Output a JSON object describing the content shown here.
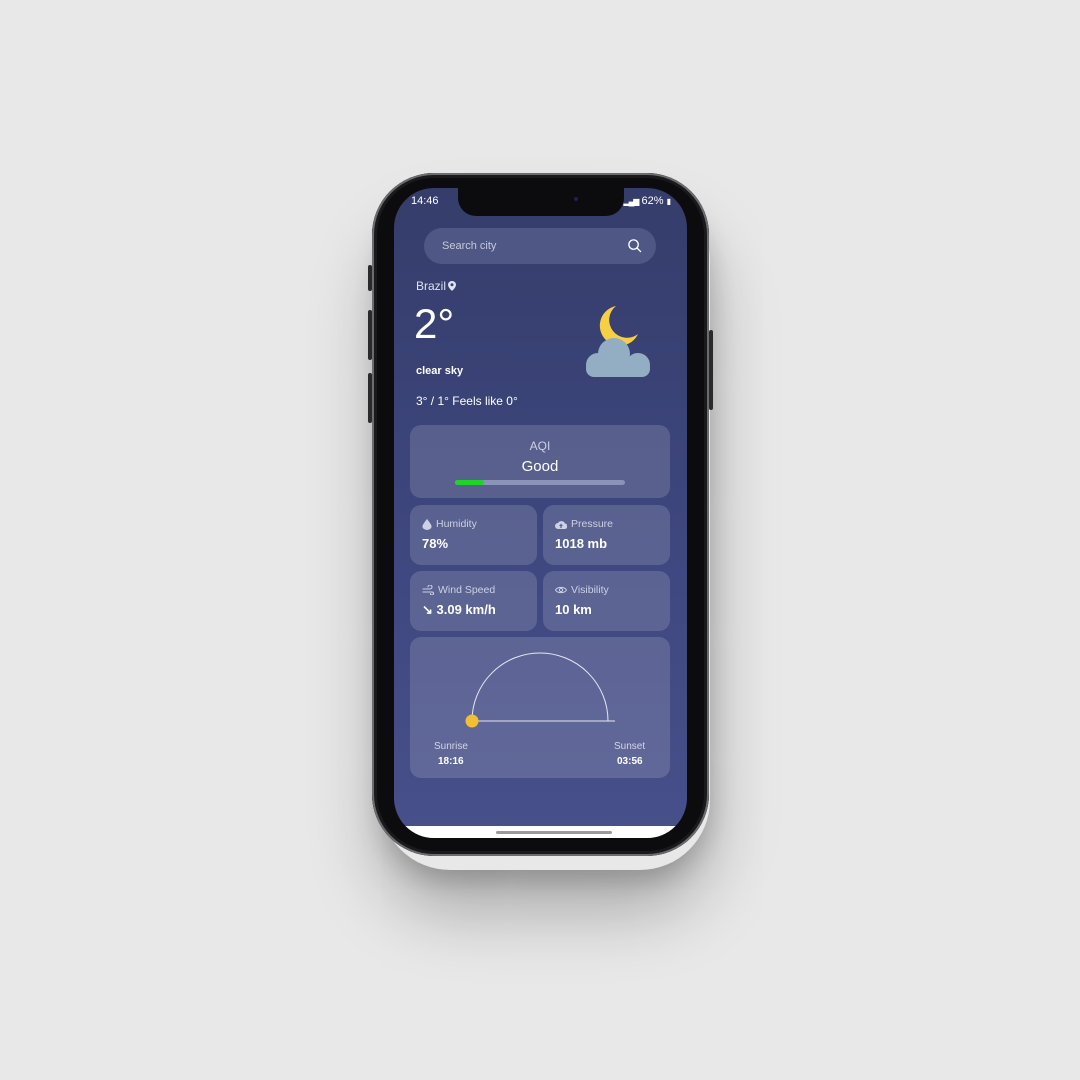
{
  "status_bar": {
    "time": "14:46",
    "signal_battery": "62%"
  },
  "search": {
    "placeholder": "Search city"
  },
  "location": "Brazil",
  "current": {
    "temperature": "2°",
    "description": "clear sky",
    "min_max_feels": "3° / 1° Feels like 0°",
    "icon": "moon-cloud-icon"
  },
  "aqi": {
    "label": "AQI",
    "value": "Good",
    "level_fraction": 0.17,
    "color": "#1ed428"
  },
  "stats": {
    "humidity": {
      "label": "Humidity",
      "value": "78%",
      "icon": "droplet-icon"
    },
    "pressure": {
      "label": "Pressure",
      "value": "1018 mb",
      "icon": "cloud-upload-icon"
    },
    "wind": {
      "label": "Wind Speed",
      "value": "↘ 3.09 km/h",
      "icon": "wind-icon"
    },
    "visibility": {
      "label": "Visibility",
      "value": "10 km",
      "icon": "eye-icon"
    }
  },
  "sun": {
    "sunrise_label": "Sunrise",
    "sunrise_time": "18:16",
    "sunset_label": "Sunset",
    "sunset_time": "03:56",
    "sun_progress": 0.0,
    "sun_color": "#f2be34"
  },
  "colors": {
    "accent_moon": "#f6cf43",
    "cloud": "#93aec2",
    "background": "#3a4275"
  }
}
